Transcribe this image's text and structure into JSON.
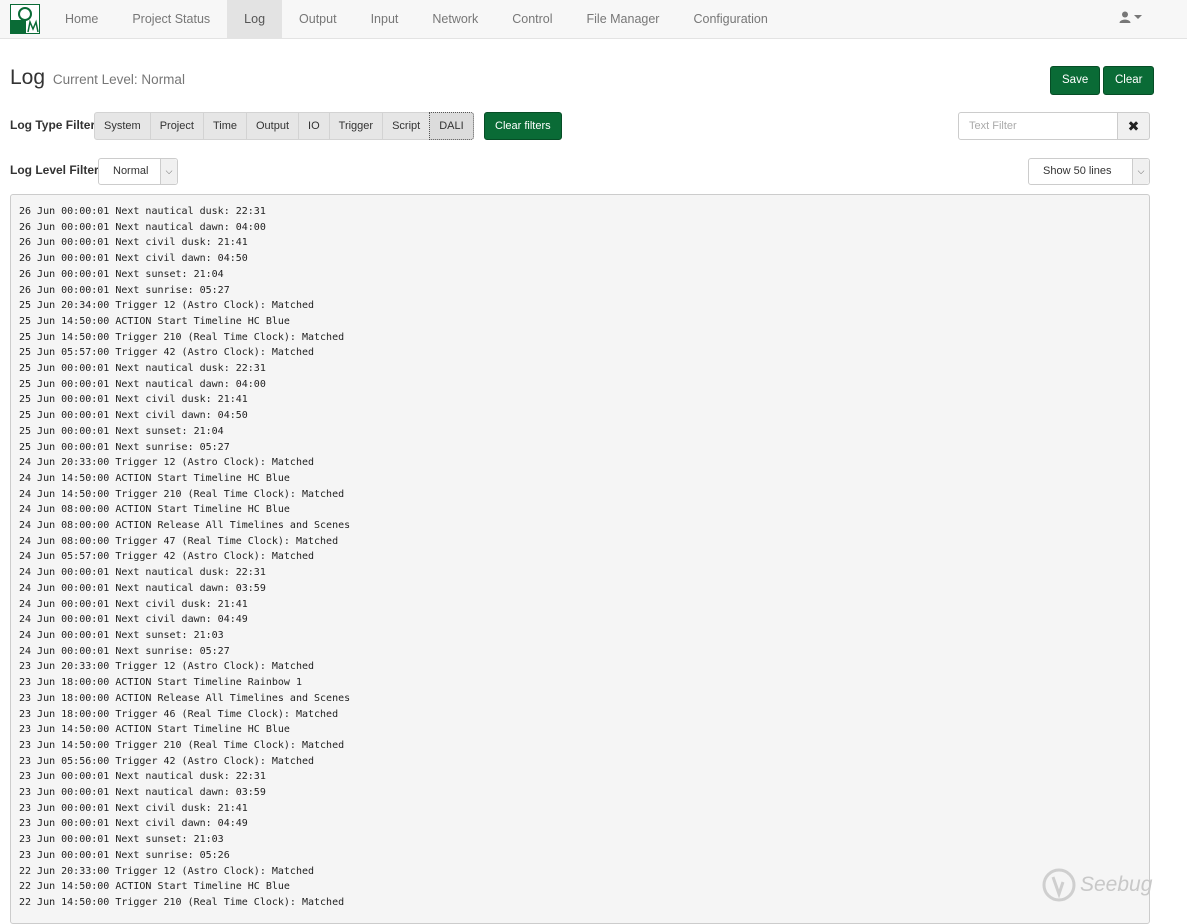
{
  "nav": {
    "items": [
      {
        "label": "Home",
        "active": false
      },
      {
        "label": "Project Status",
        "active": false
      },
      {
        "label": "Log",
        "active": true
      },
      {
        "label": "Output",
        "active": false
      },
      {
        "label": "Input",
        "active": false
      },
      {
        "label": "Network",
        "active": false
      },
      {
        "label": "Control",
        "active": false
      },
      {
        "label": "File Manager",
        "active": false
      },
      {
        "label": "Configuration",
        "active": false
      }
    ],
    "user_icon": "user-icon",
    "caret_icon": "caret-down-icon"
  },
  "page": {
    "title": "Log",
    "subtitle": "Current Level: Normal",
    "save_label": "Save",
    "clear_label": "Clear"
  },
  "filters": {
    "type_label": "Log Type Filter",
    "types": [
      "System",
      "Project",
      "Time",
      "Output",
      "IO",
      "Trigger",
      "Script",
      "DALI"
    ],
    "clear_filters_label": "Clear filters",
    "text_filter_placeholder": "Text Filter",
    "text_filter_clear": "✖",
    "level_label": "Log Level Filter",
    "level_value": "Normal",
    "lines_value": "Show 50 lines"
  },
  "log": {
    "lines": [
      "26 Jun 00:00:01 Next nautical dusk: 22:31",
      "26 Jun 00:00:01 Next nautical dawn: 04:00",
      "26 Jun 00:00:01 Next civil dusk: 21:41",
      "26 Jun 00:00:01 Next civil dawn: 04:50",
      "26 Jun 00:00:01 Next sunset: 21:04",
      "26 Jun 00:00:01 Next sunrise: 05:27",
      "25 Jun 20:34:00 Trigger 12 (Astro Clock): Matched",
      "25 Jun 14:50:00 ACTION Start Timeline HC Blue",
      "25 Jun 14:50:00 Trigger 210 (Real Time Clock): Matched",
      "25 Jun 05:57:00 Trigger 42 (Astro Clock): Matched",
      "25 Jun 00:00:01 Next nautical dusk: 22:31",
      "25 Jun 00:00:01 Next nautical dawn: 04:00",
      "25 Jun 00:00:01 Next civil dusk: 21:41",
      "25 Jun 00:00:01 Next civil dawn: 04:50",
      "25 Jun 00:00:01 Next sunset: 21:04",
      "25 Jun 00:00:01 Next sunrise: 05:27",
      "24 Jun 20:33:00 Trigger 12 (Astro Clock): Matched",
      "24 Jun 14:50:00 ACTION Start Timeline HC Blue",
      "24 Jun 14:50:00 Trigger 210 (Real Time Clock): Matched",
      "24 Jun 08:00:00 ACTION Start Timeline HC Blue",
      "24 Jun 08:00:00 ACTION Release All Timelines and Scenes",
      "24 Jun 08:00:00 Trigger 47 (Real Time Clock): Matched",
      "24 Jun 05:57:00 Trigger 42 (Astro Clock): Matched",
      "24 Jun 00:00:01 Next nautical dusk: 22:31",
      "24 Jun 00:00:01 Next nautical dawn: 03:59",
      "24 Jun 00:00:01 Next civil dusk: 21:41",
      "24 Jun 00:00:01 Next civil dawn: 04:49",
      "24 Jun 00:00:01 Next sunset: 21:03",
      "24 Jun 00:00:01 Next sunrise: 05:27",
      "23 Jun 20:33:00 Trigger 12 (Astro Clock): Matched",
      "23 Jun 18:00:00 ACTION Start Timeline Rainbow 1",
      "23 Jun 18:00:00 ACTION Release All Timelines and Scenes",
      "23 Jun 18:00:00 Trigger 46 (Real Time Clock): Matched",
      "23 Jun 14:50:00 ACTION Start Timeline HC Blue",
      "23 Jun 14:50:00 Trigger 210 (Real Time Clock): Matched",
      "23 Jun 05:56:00 Trigger 42 (Astro Clock): Matched",
      "23 Jun 00:00:01 Next nautical dusk: 22:31",
      "23 Jun 00:00:01 Next nautical dawn: 03:59",
      "23 Jun 00:00:01 Next civil dusk: 21:41",
      "23 Jun 00:00:01 Next civil dawn: 04:49",
      "23 Jun 00:00:01 Next sunset: 21:03",
      "23 Jun 00:00:01 Next sunrise: 05:26",
      "22 Jun 20:33:00 Trigger 12 (Astro Clock): Matched",
      "22 Jun 14:50:00 ACTION Start Timeline HC Blue",
      "22 Jun 14:50:00 Trigger 210 (Real Time Clock): Matched"
    ]
  },
  "watermark": {
    "text": "Seebug",
    "icon": "seebug-logo-icon"
  },
  "colors": {
    "accent": "#0a6b36",
    "nav_bg": "#f7f7f7",
    "log_bg": "#f5f5f5"
  }
}
